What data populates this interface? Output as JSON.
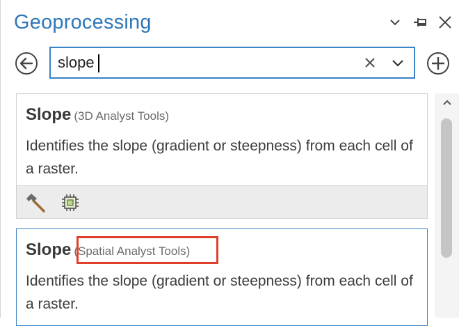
{
  "pane": {
    "title": "Geoprocessing",
    "controls": [
      "chevron-down-icon",
      "pin-icon",
      "close-icon"
    ]
  },
  "search": {
    "value": "slope",
    "back_icon": "back-arrow-icon",
    "clear_icon": "clear-x-icon",
    "dropdown_icon": "chevron-down-icon",
    "add_icon": "add-circle-icon"
  },
  "results": [
    {
      "title": "Slope",
      "toolbox": "(3D Analyst Tools)",
      "description": "Identifies the slope (gradient or steepness) from each cell of a raster.",
      "footer_icons": [
        "hammer-icon",
        "processor-chip-icon"
      ]
    },
    {
      "title": "Slope",
      "toolbox": "(Spatial Analyst Tools)",
      "description": "Identifies the slope (gradient or steepness) from each cell of a raster.",
      "highlighted": true
    }
  ],
  "colors": {
    "accent": "#3a82c6",
    "title": "#2f78b8",
    "highlight": "#e0402b"
  }
}
